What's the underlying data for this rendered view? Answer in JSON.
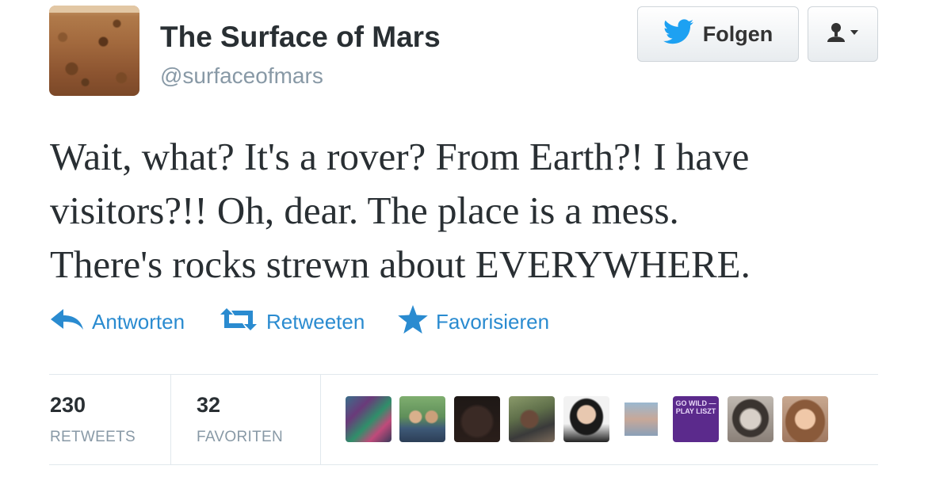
{
  "profile": {
    "name": "The Surface of Mars",
    "handle": "@surfaceofmars",
    "avatar_icon": "mars-surface-avatar"
  },
  "buttons": {
    "follow_label": "Folgen",
    "follow_icon": "twitter-bird-icon",
    "user_menu_icon": "user-dropdown-icon"
  },
  "tweet": {
    "lines": [
      "Wait, what? It's a rover? From Earth?! I have",
      "visitors?!! Oh, dear. The place is a mess.",
      "There's rocks strewn about EVERYWHERE."
    ]
  },
  "actions": [
    {
      "label": "Antworten",
      "icon": "reply-icon"
    },
    {
      "label": "Retweeten",
      "icon": "retweet-icon"
    },
    {
      "label": "Favorisieren",
      "icon": "star-icon"
    }
  ],
  "stats": {
    "retweets_count": "230",
    "retweets_label": "RETWEETS",
    "favorites_count": "32",
    "favorites_label": "FAVORITEN"
  },
  "favoriter_avatars": [
    {
      "name": "avatar-1"
    },
    {
      "name": "avatar-2"
    },
    {
      "name": "avatar-3"
    },
    {
      "name": "avatar-4"
    },
    {
      "name": "avatar-5"
    },
    {
      "name": "avatar-6"
    },
    {
      "name": "avatar-7",
      "text": "GO WILD — PLAY LISZT"
    },
    {
      "name": "avatar-8"
    },
    {
      "name": "avatar-9"
    }
  ],
  "colors": {
    "link_blue": "#2a8bd0",
    "twitter_blue": "#1da1f2",
    "muted_gray": "#8899a6"
  }
}
